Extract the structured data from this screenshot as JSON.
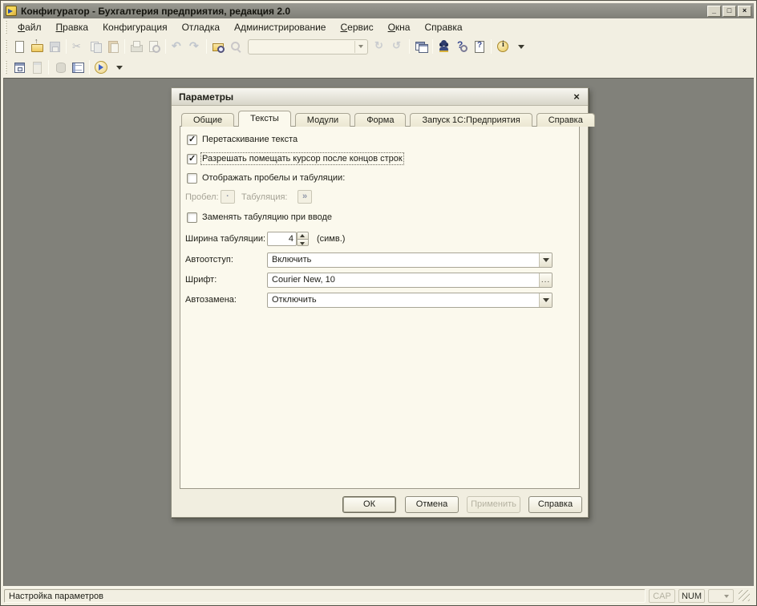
{
  "window": {
    "title": "Конфигуратор - Бухгалтерия предприятия, редакция 2.0",
    "controls": {
      "minimize": "_",
      "maximize": "□",
      "close": "×"
    }
  },
  "menu": {
    "items": [
      {
        "pre": "",
        "u": "Ф",
        "post": "айл"
      },
      {
        "pre": "",
        "u": "П",
        "post": "равка"
      },
      {
        "pre": "Конфигурация",
        "u": "",
        "post": ""
      },
      {
        "pre": "Отладка",
        "u": "",
        "post": ""
      },
      {
        "pre": "Администрирование",
        "u": "",
        "post": ""
      },
      {
        "pre": "",
        "u": "С",
        "post": "ервис"
      },
      {
        "pre": "",
        "u": "О",
        "post": "кна"
      },
      {
        "pre": "Справка",
        "u": "",
        "post": ""
      }
    ]
  },
  "toolbar_main": {
    "icons": [
      "new-document",
      "open",
      "save",
      "cut",
      "copy",
      "paste",
      "print",
      "print-preview",
      "undo",
      "redo",
      "find-in-files",
      "zoom",
      "search-combobox",
      "search-next",
      "search-previous",
      "copy-window",
      "syntax-assistant",
      "help-search",
      "help-contents",
      "info",
      "more-buttons"
    ],
    "search_combo_value": ""
  },
  "toolbar_config": {
    "icons": [
      "configuration-window",
      "properties",
      "database",
      "exchange-table",
      "start-debugging",
      "more-buttons"
    ]
  },
  "dialog": {
    "title": "Параметры",
    "close_glyph": "×",
    "tabs": [
      "Общие",
      "Тексты",
      "Модули",
      "Форма",
      "Запуск 1С:Предприятия",
      "Справка"
    ],
    "active_tab": "Тексты",
    "checkboxes": {
      "drag_text": {
        "label": "Перетаскивание текста",
        "checked": true
      },
      "cursor_after_eol": {
        "label": "Разрешать помещать курсор после концов строк",
        "checked": true,
        "focused": true
      },
      "show_spaces_tabs": {
        "label": "Отображать пробелы и табуляции:",
        "checked": false
      },
      "replace_tab_on_input": {
        "label": "Заменять табуляцию при вводе",
        "checked": false
      }
    },
    "space_tab_row": {
      "space_label": "Пробел:",
      "space_glyph": "·",
      "tab_label": "Табуляция:",
      "tab_glyph": "»",
      "disabled": true
    },
    "tab_width": {
      "label": "Ширина табуляции:",
      "value": "4",
      "suffix": "(симв.)"
    },
    "autoindent": {
      "label": "Автоотступ:",
      "value": "Включить"
    },
    "font": {
      "label": "Шрифт:",
      "value": "Courier New, 10",
      "button": "..."
    },
    "autocorrect": {
      "label": "Автозамена:",
      "value": "Отключить"
    },
    "buttons": {
      "ok": "ОК",
      "cancel": "Отмена",
      "apply": "Применить",
      "help": "Справка"
    }
  },
  "statusbar": {
    "message": "Настройка параметров",
    "cap": "CAP",
    "num": "NUM"
  }
}
